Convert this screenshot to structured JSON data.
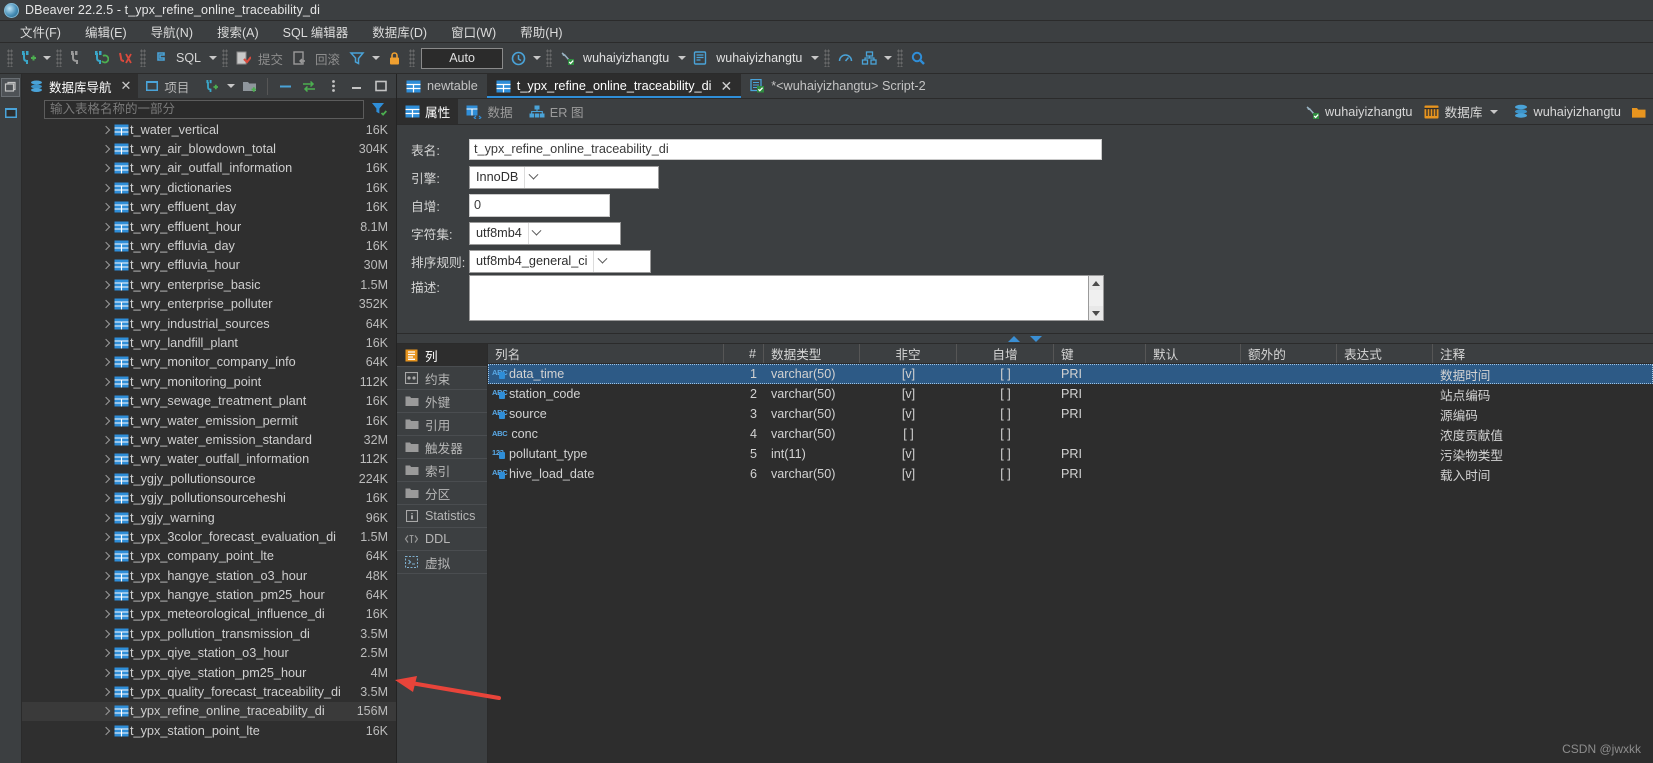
{
  "window": {
    "title": "DBeaver 22.2.5 - t_ypx_refine_online_traceability_di",
    "app_icon": "dbeaver-logo-icon"
  },
  "menubar": [
    {
      "label": "文件(F)"
    },
    {
      "label": "编辑(E)"
    },
    {
      "label": "导航(N)"
    },
    {
      "label": "搜索(A)"
    },
    {
      "label": "SQL 编辑器"
    },
    {
      "label": "数据库(D)"
    },
    {
      "label": "窗口(W)"
    },
    {
      "label": "帮助(H)"
    }
  ],
  "toolbar": {
    "sql_label": "SQL",
    "commit_label": "提交",
    "rollback_label": "回滚",
    "auto_label": "Auto",
    "connection_value": "wuhaiyizhangtu",
    "database_value": "wuhaiyizhangtu"
  },
  "navigator": {
    "tabs": [
      {
        "label": "数据库导航",
        "active": true,
        "closable": true
      },
      {
        "label": "项目",
        "active": false,
        "closable": false
      }
    ],
    "filter_placeholder": "输入表格名称的一部分",
    "filter_value": "",
    "tables": [
      {
        "name": "t_water_vertical",
        "size": "16K"
      },
      {
        "name": "t_wry_air_blowdown_total",
        "size": "304K"
      },
      {
        "name": "t_wry_air_outfall_information",
        "size": "16K"
      },
      {
        "name": "t_wry_dictionaries",
        "size": "16K"
      },
      {
        "name": "t_wry_effluent_day",
        "size": "16K"
      },
      {
        "name": "t_wry_effluent_hour",
        "size": "8.1M"
      },
      {
        "name": "t_wry_effluvia_day",
        "size": "16K"
      },
      {
        "name": "t_wry_effluvia_hour",
        "size": "30M"
      },
      {
        "name": "t_wry_enterprise_basic",
        "size": "1.5M"
      },
      {
        "name": "t_wry_enterprise_polluter",
        "size": "352K"
      },
      {
        "name": "t_wry_industrial_sources",
        "size": "64K"
      },
      {
        "name": "t_wry_landfill_plant",
        "size": "16K"
      },
      {
        "name": "t_wry_monitor_company_info",
        "size": "64K"
      },
      {
        "name": "t_wry_monitoring_point",
        "size": "112K"
      },
      {
        "name": "t_wry_sewage_treatment_plant",
        "size": "16K"
      },
      {
        "name": "t_wry_water_emission_permit",
        "size": "16K"
      },
      {
        "name": "t_wry_water_emission_standard",
        "size": "32M"
      },
      {
        "name": "t_wry_water_outfall_information",
        "size": "112K"
      },
      {
        "name": "t_ygjy_pollutionsource",
        "size": "224K"
      },
      {
        "name": "t_ygjy_pollutionsourceheshi",
        "size": "16K"
      },
      {
        "name": "t_ygjy_warning",
        "size": "96K"
      },
      {
        "name": "t_ypx_3color_forecast_evaluation_di",
        "size": "1.5M"
      },
      {
        "name": "t_ypx_company_point_lte",
        "size": "64K"
      },
      {
        "name": "t_ypx_hangye_station_o3_hour",
        "size": "48K"
      },
      {
        "name": "t_ypx_hangye_station_pm25_hour",
        "size": "64K"
      },
      {
        "name": "t_ypx_meteorological_influence_di",
        "size": "16K"
      },
      {
        "name": "t_ypx_pollution_transmission_di",
        "size": "3.5M"
      },
      {
        "name": "t_ypx_qiye_station_o3_hour",
        "size": "2.5M"
      },
      {
        "name": "t_ypx_qiye_station_pm25_hour",
        "size": "4M"
      },
      {
        "name": "t_ypx_quality_forecast_traceability_di",
        "size": "3.5M"
      },
      {
        "name": "t_ypx_refine_online_traceability_di",
        "size": "156M",
        "selected": true
      },
      {
        "name": "t_ypx_station_point_lte",
        "size": "16K"
      }
    ]
  },
  "editor": {
    "tabs": [
      {
        "label": "newtable",
        "active": false,
        "icon": "table-icon",
        "closable": false
      },
      {
        "label": "t_ypx_refine_online_traceability_di",
        "active": true,
        "icon": "table-icon",
        "closable": true
      },
      {
        "label": "*<wuhaiyizhangtu> Script-2",
        "active": false,
        "icon": "script-icon",
        "closable": false
      }
    ],
    "subtabs": [
      {
        "label": "属性",
        "active": true,
        "icon": "properties-icon"
      },
      {
        "label": "数据",
        "active": false,
        "icon": "data-icon"
      },
      {
        "label": "ER 图",
        "active": false,
        "icon": "er-diagram-icon"
      }
    ],
    "header_right": [
      {
        "label": "wuhaiyizhangtu",
        "icon": "connection-icon"
      },
      {
        "label": "数据库",
        "icon": "database-orange-icon"
      },
      {
        "label": "wuhaiyizhangtu",
        "icon": "schema-icon"
      }
    ]
  },
  "properties": {
    "fields": [
      {
        "label": "表名:",
        "value": "t_ypx_refine_online_traceability_di",
        "type": "text"
      },
      {
        "label": "引擎:",
        "value": "InnoDB",
        "type": "select"
      },
      {
        "label": "自增:",
        "value": "0",
        "type": "text"
      },
      {
        "label": "字符集:",
        "value": "utf8mb4",
        "type": "select"
      },
      {
        "label": "排序规则:",
        "value": "utf8mb4_general_ci",
        "type": "select"
      },
      {
        "label": "描述:",
        "value": "",
        "type": "textarea"
      }
    ]
  },
  "side_tabs": [
    {
      "label": "列",
      "active": true,
      "icon": "columns-icon"
    },
    {
      "label": "约束",
      "active": false,
      "icon": "constraint-icon"
    },
    {
      "label": "外键",
      "active": false,
      "icon": "folder-icon"
    },
    {
      "label": "引用",
      "active": false,
      "icon": "folder-icon"
    },
    {
      "label": "触发器",
      "active": false,
      "icon": "folder-icon"
    },
    {
      "label": "索引",
      "active": false,
      "icon": "folder-icon"
    },
    {
      "label": "分区",
      "active": false,
      "icon": "folder-icon"
    },
    {
      "label": "Statistics",
      "active": false,
      "icon": "info-icon"
    },
    {
      "label": "DDL",
      "active": false,
      "icon": "ddl-icon"
    },
    {
      "label": "虚拟",
      "active": false,
      "icon": "virtual-icon"
    }
  ],
  "columns_grid": {
    "headers": [
      "列名",
      "#",
      "数据类型",
      "非空",
      "自增",
      "键",
      "默认",
      "额外的",
      "表达式",
      "注释"
    ],
    "rows": [
      {
        "name": "data_time",
        "type_icon": "string-key-icon",
        "num": "1",
        "datatype": "varchar(50)",
        "notnull": "[v]",
        "autoinc": "[ ]",
        "key": "PRI",
        "default": "",
        "extra": "",
        "expression": "",
        "comment": "数据时间",
        "selected": true
      },
      {
        "name": "station_code",
        "type_icon": "string-key-icon",
        "num": "2",
        "datatype": "varchar(50)",
        "notnull": "[v]",
        "autoinc": "[ ]",
        "key": "PRI",
        "default": "",
        "extra": "",
        "expression": "",
        "comment": "站点编码"
      },
      {
        "name": "source",
        "type_icon": "string-key-icon",
        "num": "3",
        "datatype": "varchar(50)",
        "notnull": "[v]",
        "autoinc": "[ ]",
        "key": "PRI",
        "default": "",
        "extra": "",
        "expression": "",
        "comment": "源编码"
      },
      {
        "name": "conc",
        "type_icon": "string-icon",
        "num": "4",
        "datatype": "varchar(50)",
        "notnull": "[ ]",
        "autoinc": "[ ]",
        "key": "",
        "default": "",
        "extra": "",
        "expression": "",
        "comment": "浓度贡献值"
      },
      {
        "name": "pollutant_type",
        "type_icon": "number-key-icon",
        "num": "5",
        "datatype": "int(11)",
        "notnull": "[v]",
        "autoinc": "[ ]",
        "key": "PRI",
        "default": "",
        "extra": "",
        "expression": "",
        "comment": "污染物类型"
      },
      {
        "name": "hive_load_date",
        "type_icon": "string-key-icon",
        "num": "6",
        "datatype": "varchar(50)",
        "notnull": "[v]",
        "autoinc": "[ ]",
        "key": "PRI",
        "default": "",
        "extra": "",
        "expression": "",
        "comment": "载入时间"
      }
    ]
  },
  "watermark": "CSDN @jwxkk",
  "colors": {
    "accent": "#3a8fd4",
    "selection": "#2d5a86",
    "panel": "#3c3f41",
    "background": "#2d2d2d",
    "annotation_arrow": "#e8443a"
  }
}
